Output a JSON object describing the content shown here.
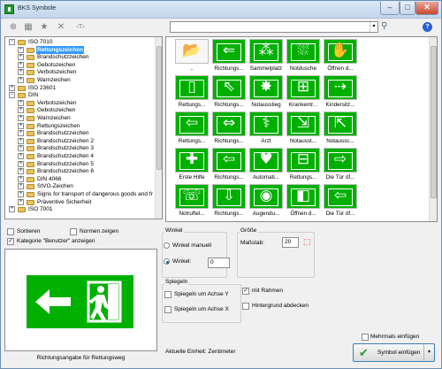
{
  "window": {
    "title": "BKS Symbole",
    "controls": [
      "–",
      "□",
      "✕"
    ]
  },
  "toolbar": {
    "tool_glyphs": [
      "⊕",
      "▦",
      "★",
      "✕",
      "‹T›"
    ],
    "search_value": "",
    "search_dropdown": "▾",
    "search_icon": "⚲",
    "help": "?"
  },
  "tree": {
    "items": [
      {
        "indent": 0,
        "exp": "−",
        "label": "ISO 7010",
        "selected": false
      },
      {
        "indent": 1,
        "exp": "+",
        "label": "Rettungszeichen",
        "selected": true
      },
      {
        "indent": 1,
        "exp": "+",
        "label": "Brandschutzzeichen",
        "selected": false
      },
      {
        "indent": 1,
        "exp": "+",
        "label": "Gebotszeichen",
        "selected": false
      },
      {
        "indent": 1,
        "exp": "+",
        "label": "Verbotszeichen",
        "selected": false
      },
      {
        "indent": 1,
        "exp": "+",
        "label": "Warnzeichen",
        "selected": false
      },
      {
        "indent": 0,
        "exp": "+",
        "label": "ISO 23601",
        "selected": false
      },
      {
        "indent": 0,
        "exp": "−",
        "label": "DIN",
        "selected": false
      },
      {
        "indent": 1,
        "exp": "+",
        "label": "Verbotszeichen",
        "selected": false
      },
      {
        "indent": 1,
        "exp": "+",
        "label": "Gebotszeichen",
        "selected": false
      },
      {
        "indent": 1,
        "exp": "+",
        "label": "Warnzeichen",
        "selected": false
      },
      {
        "indent": 1,
        "exp": "+",
        "label": "Rettungszeichen",
        "selected": false
      },
      {
        "indent": 1,
        "exp": "+",
        "label": "Brandschutzzeichen",
        "selected": false
      },
      {
        "indent": 1,
        "exp": "+",
        "label": "Brandschutzzeichen 2",
        "selected": false
      },
      {
        "indent": 1,
        "exp": "+",
        "label": "Brandschutzzeichen 3",
        "selected": false
      },
      {
        "indent": 1,
        "exp": "+",
        "label": "Brandschutzzeichen 4",
        "selected": false
      },
      {
        "indent": 1,
        "exp": "+",
        "label": "Brandschutzzeichen 5",
        "selected": false
      },
      {
        "indent": 1,
        "exp": "+",
        "label": "Brandschutzzeichen 6",
        "selected": false
      },
      {
        "indent": 1,
        "exp": "+",
        "label": "DIN 4066",
        "selected": false
      },
      {
        "indent": 1,
        "exp": "+",
        "label": "StVO-Zeichen",
        "selected": false
      },
      {
        "indent": 1,
        "exp": "+",
        "label": "Signs for transport of dangerous goods and fr",
        "selected": false
      },
      {
        "indent": 1,
        "exp": "+",
        "label": "Präventive Sicherheit",
        "selected": false
      },
      {
        "indent": 0,
        "exp": "+",
        "label": "ISO 7001",
        "selected": false
      }
    ]
  },
  "symbols": {
    "items": [
      {
        "label": "..",
        "glyph": "📂",
        "kind": "up"
      },
      {
        "label": "Richtungs...",
        "glyph": "⇐",
        "kind": "sign"
      },
      {
        "label": "Sammelplatz",
        "glyph": "⁂",
        "kind": "sign"
      },
      {
        "label": "Notdusche",
        "glyph": "⛆",
        "kind": "sign"
      },
      {
        "label": "Öffnen d...",
        "glyph": "✋",
        "kind": "sign"
      },
      {
        "label": "Rettungs...",
        "glyph": "▯",
        "kind": "sign"
      },
      {
        "label": "Richtungs...",
        "glyph": "⇖",
        "kind": "sign"
      },
      {
        "label": "Notausstieg",
        "glyph": "✸",
        "kind": "sign"
      },
      {
        "label": "Krankentr...",
        "glyph": "⊞",
        "kind": "sign"
      },
      {
        "label": "Kindersitz...",
        "glyph": "⇢",
        "kind": "sign"
      },
      {
        "label": "Rettungs...",
        "glyph": "⇦",
        "kind": "sign"
      },
      {
        "label": "Richtungs...",
        "glyph": "⇔",
        "kind": "sign"
      },
      {
        "label": "Arzt",
        "glyph": "⚕",
        "kind": "sign"
      },
      {
        "label": "Notausst...",
        "glyph": "⇲",
        "kind": "sign"
      },
      {
        "label": "Notaussc...",
        "glyph": "⇱",
        "kind": "sign"
      },
      {
        "label": "Erste Hilfe",
        "glyph": "✚",
        "kind": "sign"
      },
      {
        "label": "Richtungs...",
        "glyph": "⇦",
        "kind": "sign"
      },
      {
        "label": "Automati...",
        "glyph": "♥",
        "kind": "sign"
      },
      {
        "label": "Rettungs...",
        "glyph": "⊟",
        "kind": "sign"
      },
      {
        "label": "Die Tür öf...",
        "glyph": "⇨",
        "kind": "sign"
      },
      {
        "label": "Notruftel...",
        "glyph": "☏",
        "kind": "sign"
      },
      {
        "label": "Richtungs...",
        "glyph": "⇩",
        "kind": "sign"
      },
      {
        "label": "Augendu...",
        "glyph": "◉",
        "kind": "sign"
      },
      {
        "label": "Öffnen d...",
        "glyph": "◧",
        "kind": "sign"
      },
      {
        "label": "Die Tür öf...",
        "glyph": "⇦",
        "kind": "sign"
      }
    ]
  },
  "options": {
    "sortieren": "Sortieren",
    "normen_zeigen": "Normen zeigen",
    "kategorie_benutzer": "Kategorie \"Benutzer\" anzeigen"
  },
  "preview": {
    "caption": "Richtungsangabe für Rettungsweg",
    "sign_glyph": "⇐"
  },
  "winkel": {
    "title": "Winkel",
    "manuell_label": "Winkel manuell",
    "winkel_label": "Winkel:",
    "winkel_value": "0"
  },
  "groesse": {
    "title": "Größe",
    "massstab_label": "Maßstab:",
    "massstab_value": "20"
  },
  "spiegeln": {
    "title": "Spiegeln",
    "achse_y": "Spiegeln um Achse Y",
    "achse_x": "Spiegeln um Achse X"
  },
  "rahmen": {
    "mit_rahmen": "mit Rahmen",
    "hintergrund": "Hintergrund abdecken"
  },
  "status": {
    "einheit": "Aktuelle Einheit: Zentimeter"
  },
  "footer": {
    "mehrmals": "Mehrmals einfügen",
    "symbol_einfuegen": "Symbol einfügen",
    "ok_glyph": "✔",
    "drop_glyph": "▾"
  },
  "colors": {
    "sign_green": "#00b000",
    "selection": "#3399ff"
  }
}
